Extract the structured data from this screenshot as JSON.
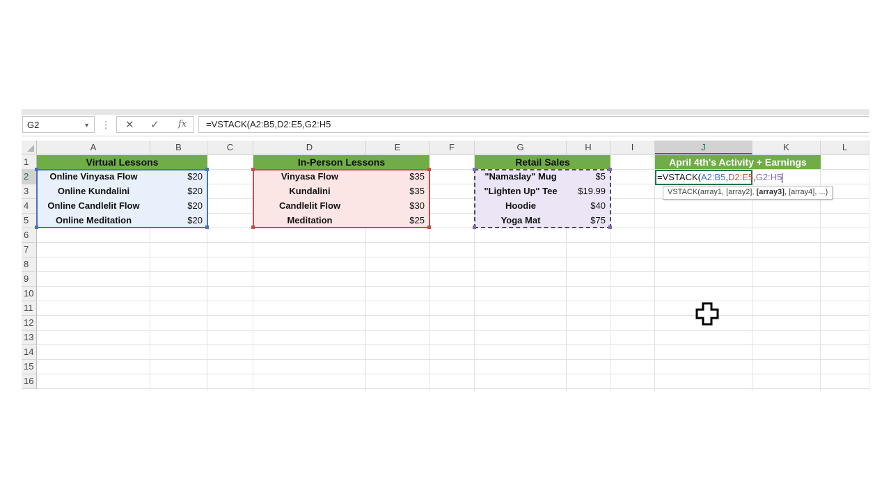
{
  "formula_bar": {
    "name_box": "G2",
    "cancel_glyph": "✕",
    "enter_glyph": "✓",
    "fx_label": "fx",
    "formula": "=VSTACK(A2:B5,D2:E5,G2:H5"
  },
  "columns": [
    "A",
    "B",
    "C",
    "D",
    "E",
    "F",
    "G",
    "H",
    "I",
    "J",
    "K",
    "L"
  ],
  "rows": [
    "1",
    "2",
    "3",
    "4",
    "5",
    "6",
    "7",
    "8",
    "9",
    "10",
    "11",
    "12",
    "13",
    "14",
    "15",
    "16"
  ],
  "virtual": {
    "title": "Virtual Lessons",
    "items": [
      {
        "name": "Online Vinyasa Flow",
        "price": "$20"
      },
      {
        "name": "Online Kundalini",
        "price": "$20"
      },
      {
        "name": "Online Candlelit Flow",
        "price": "$20"
      },
      {
        "name": "Online Meditation",
        "price": "$20"
      }
    ]
  },
  "inperson": {
    "title": "In-Person Lessons",
    "items": [
      {
        "name": "Vinyasa Flow",
        "price": "$35"
      },
      {
        "name": "Kundalini",
        "price": "$35"
      },
      {
        "name": "Candlelit Flow",
        "price": "$30"
      },
      {
        "name": "Meditation",
        "price": "$25"
      }
    ]
  },
  "retail": {
    "title": "Retail Sales",
    "items": [
      {
        "name": "\"Namaslay\" Mug",
        "price": "$5"
      },
      {
        "name": "\"Lighten Up\" Tee",
        "price": "$19.99"
      },
      {
        "name": "Hoodie",
        "price": "$40"
      },
      {
        "name": "Yoga Mat",
        "price": "$75"
      }
    ]
  },
  "summary": {
    "title": "April 4th's Activity + Earnings"
  },
  "edit": {
    "prefix": "=VSTACK(",
    "ref1": "A2:B5",
    "sep1": ",",
    "ref2": "D2:E5",
    "sep2": ",",
    "ref3": "G2:H5"
  },
  "tooltip": {
    "pre": "VSTACK(array1, [array2], ",
    "bold": "[array3]",
    "post": ", [array4], ...)"
  },
  "colors": {
    "header_green": "#70ad47",
    "ref_blue": "#4472c4",
    "ref_red": "#c0504d",
    "ref_purple": "#7f6ab3",
    "selection_green": "#217346"
  }
}
